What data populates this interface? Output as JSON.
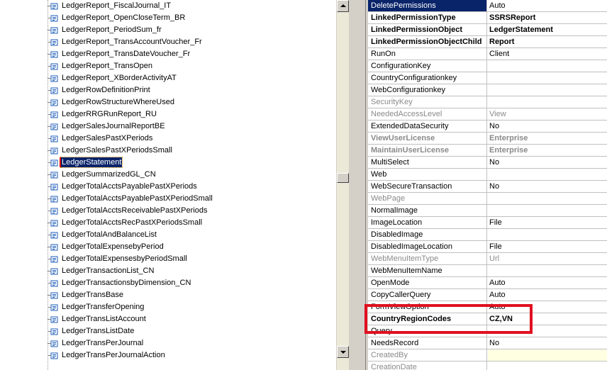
{
  "tree": {
    "items": [
      {
        "label": "LedgerReport_FiscalJournal_IT",
        "selected": false
      },
      {
        "label": "LedgerReport_OpenCloseTerm_BR",
        "selected": false
      },
      {
        "label": "LedgerReport_PeriodSum_fr",
        "selected": false
      },
      {
        "label": "LedgerReport_TransAccountVoucher_Fr",
        "selected": false
      },
      {
        "label": "LedgerReport_TransDateVoucher_Fr",
        "selected": false
      },
      {
        "label": "LedgerReport_TransOpen",
        "selected": false
      },
      {
        "label": "LedgerReport_XBorderActivityAT",
        "selected": false
      },
      {
        "label": "LedgerRowDefinitionPrint",
        "selected": false
      },
      {
        "label": "LedgerRowStructureWhereUsed",
        "selected": false
      },
      {
        "label": "LedgerRRGRunReport_RU",
        "selected": false
      },
      {
        "label": "LedgerSalesJournalReportBE",
        "selected": false
      },
      {
        "label": "LedgerSalesPastXPeriods",
        "selected": false
      },
      {
        "label": "LedgerSalesPastXPeriodsSmall",
        "selected": false
      },
      {
        "label": "LedgerStatement",
        "selected": true
      },
      {
        "label": "LedgerSummarizedGL_CN",
        "selected": false
      },
      {
        "label": "LedgerTotalAcctsPayablePastXPeriods",
        "selected": false
      },
      {
        "label": "LedgerTotalAcctsPayablePastXPeriodSmall",
        "selected": false
      },
      {
        "label": "LedgerTotalAcctsReceivablePastXPeriods",
        "selected": false
      },
      {
        "label": "LedgerTotalAcctsRecPastXPeriodsSmall",
        "selected": false
      },
      {
        "label": "LedgerTotalAndBalanceList",
        "selected": false
      },
      {
        "label": "LedgerTotalExpensebyPeriod",
        "selected": false
      },
      {
        "label": "LedgerTotalExpensesbyPeriodSmall",
        "selected": false
      },
      {
        "label": "LedgerTransactionList_CN",
        "selected": false
      },
      {
        "label": "LedgerTransactionsbyDimension_CN",
        "selected": false
      },
      {
        "label": "LedgerTransBase",
        "selected": false
      },
      {
        "label": "LedgerTransferOpening",
        "selected": false
      },
      {
        "label": "LedgerTransListAccount",
        "selected": false
      },
      {
        "label": "LedgerTransListDate",
        "selected": false
      },
      {
        "label": "LedgerTransPerJournal",
        "selected": false
      },
      {
        "label": "LedgerTransPerJournalAction",
        "selected": false
      }
    ],
    "icon": "menu-item-output-icon"
  },
  "properties": {
    "rows": [
      {
        "name": "DeletePermissions",
        "value": "Auto",
        "style": "highlight"
      },
      {
        "name": "LinkedPermissionType",
        "value": "SSRSReport",
        "style": "bold"
      },
      {
        "name": "LinkedPermissionObject",
        "value": "LedgerStatement",
        "style": "bold"
      },
      {
        "name": "LinkedPermissionObjectChild",
        "value": "Report",
        "style": "bold"
      },
      {
        "name": "RunOn",
        "value": "Client",
        "style": ""
      },
      {
        "name": "ConfigurationKey",
        "value": "",
        "style": ""
      },
      {
        "name": "CountryConfigurationkey",
        "value": "",
        "style": ""
      },
      {
        "name": "WebConfigurationkey",
        "value": "",
        "style": ""
      },
      {
        "name": "SecurityKey",
        "value": "",
        "style": "disabled"
      },
      {
        "name": "NeededAccessLevel",
        "value": "View",
        "style": "disabled"
      },
      {
        "name": "ExtendedDataSecurity",
        "value": "No",
        "style": ""
      },
      {
        "name": "ViewUserLicense",
        "value": "Enterprise",
        "style": "bold disabled"
      },
      {
        "name": "MaintainUserLicense",
        "value": "Enterprise",
        "style": "bold disabled"
      },
      {
        "name": "MultiSelect",
        "value": "No",
        "style": ""
      },
      {
        "name": "Web",
        "value": "",
        "style": ""
      },
      {
        "name": "WebSecureTransaction",
        "value": "No",
        "style": ""
      },
      {
        "name": "WebPage",
        "value": "",
        "style": "disabled"
      },
      {
        "name": "NormalImage",
        "value": "",
        "style": ""
      },
      {
        "name": "ImageLocation",
        "value": "File",
        "style": ""
      },
      {
        "name": "DisabledImage",
        "value": "",
        "style": ""
      },
      {
        "name": "DisabledImageLocation",
        "value": "File",
        "style": ""
      },
      {
        "name": "WebMenuItemType",
        "value": "Url",
        "style": "disabled"
      },
      {
        "name": "WebMenuItemName",
        "value": "",
        "style": ""
      },
      {
        "name": "OpenMode",
        "value": "Auto",
        "style": ""
      },
      {
        "name": "CopyCallerQuery",
        "value": "Auto",
        "style": ""
      },
      {
        "name": "FormViewOption",
        "value": "Auto",
        "style": ""
      },
      {
        "name": "CountryRegionCodes",
        "value": "CZ,VN",
        "style": "bold"
      },
      {
        "name": "Query",
        "value": "",
        "style": ""
      },
      {
        "name": "NeedsRecord",
        "value": "No",
        "style": ""
      },
      {
        "name": "CreatedBy",
        "value": "",
        "style": "disabled yellow"
      },
      {
        "name": "CreationDate",
        "value": "",
        "style": "disabled"
      }
    ]
  },
  "colors": {
    "selection": "#0a246a",
    "callout": "#e01020",
    "disabled_text": "#8a8a8a"
  }
}
